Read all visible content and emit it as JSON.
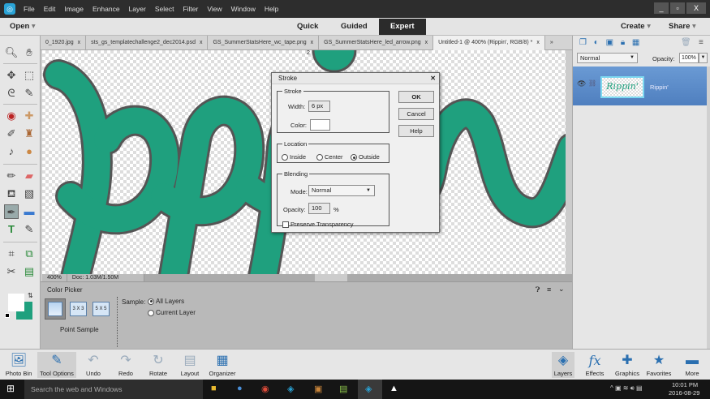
{
  "menu": [
    "File",
    "Edit",
    "Image",
    "Enhance",
    "Layer",
    "Select",
    "Filter",
    "View",
    "Window",
    "Help"
  ],
  "window_controls": {
    "minimize": "_",
    "restore": "▫",
    "close": "X"
  },
  "modebar": {
    "open": "Open",
    "quick": "Quick",
    "guided": "Guided",
    "expert": "Expert",
    "create": "Create",
    "share": "Share"
  },
  "tabs": [
    "0_1920.jpg",
    "sts_gs_templatechallenge2_dec2014.psd",
    "GS_SummerStatsHere_wc_tape.png",
    "GS_SummerStatsHere_led_arrow.png",
    "Untitled-1 @ 400% (Rippin', RGB/8) *"
  ],
  "tab_close": "x",
  "tab_overflow": "»",
  "ruler_mark": "2",
  "status": {
    "zoom": "400%",
    "doc": "Doc: 1.03M/1.50M"
  },
  "dialog": {
    "title": "Stroke",
    "close": "✕",
    "stroke_legend": "Stroke",
    "width_label": "Width:",
    "width_value": "6 px",
    "color_label": "Color:",
    "color_value": "#ffffff",
    "location_legend": "Location",
    "inside": "Inside",
    "center": "Center",
    "outside": "Outside",
    "location_selected": "Outside",
    "blending_legend": "Blending",
    "mode_label": "Mode:",
    "mode_value": "Normal",
    "opacity_label": "Opacity:",
    "opacity_value": "100",
    "opacity_unit": "%",
    "preserve": "Preserve Transparency",
    "preserve_checked": false,
    "ok": "OK",
    "cancel": "Cancel",
    "help": "Help"
  },
  "options": {
    "title": "Color Picker",
    "sizes": [
      "3 X 3",
      "5 X 5"
    ],
    "point_sample": "Point Sample",
    "sample_label": "Sample:",
    "all_layers": "All Layers",
    "current_layer": "Current Layer",
    "sample_selected": "All Layers"
  },
  "layers": {
    "blend_mode": "Normal",
    "opacity_label": "Opacity:",
    "opacity_value": "100%",
    "layer_name": "Rippin'",
    "thumb_text": "Rippin'"
  },
  "bottom_left": [
    "Photo Bin",
    "Tool Options",
    "Undo",
    "Redo",
    "Rotate",
    "Layout",
    "Organizer"
  ],
  "bottom_right": [
    "Layers",
    "Effects",
    "Graphics",
    "Favorites",
    "More"
  ],
  "taskbar": {
    "search": "Search the web and Windows",
    "time": "10:01 PM",
    "date": "2016-08-29"
  },
  "colors": {
    "teal": "#1fa07e",
    "accent_blue": "#5b8fc9",
    "fg": "#ffffff",
    "bg": "#1fa07e"
  }
}
